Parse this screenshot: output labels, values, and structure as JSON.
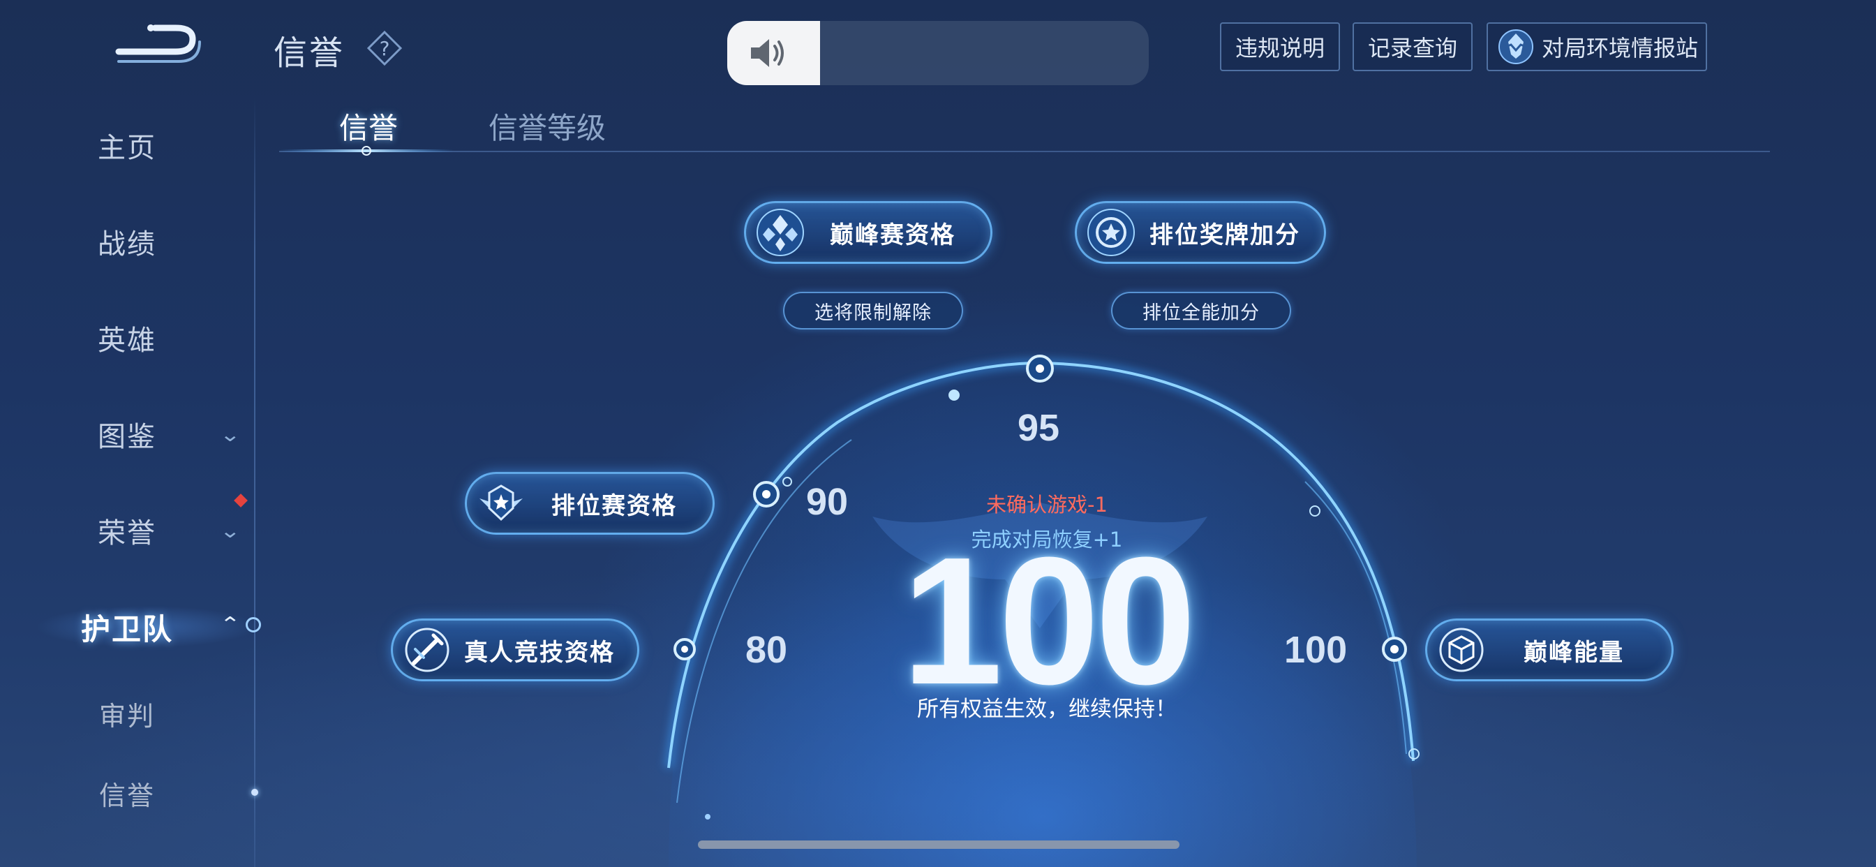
{
  "sidebar": {
    "items": [
      {
        "label": "主页"
      },
      {
        "label": "战绩"
      },
      {
        "label": "英雄"
      },
      {
        "label": "图鉴",
        "expandable": true
      },
      {
        "label": "荣誉",
        "expandable": true,
        "badge": true
      },
      {
        "label": "护卫队",
        "expanded": true,
        "active": true
      },
      {
        "label": "审判"
      },
      {
        "label": "信誉",
        "selected": true
      }
    ]
  },
  "header": {
    "title": "信誉",
    "help_icon": "question-icon",
    "buttons": {
      "violation": "违规说明",
      "records": "记录查询",
      "env_station": "对局环境情报站"
    }
  },
  "volume_hud": {
    "level": 0.22,
    "icon": "speaker-icon"
  },
  "tabs": [
    {
      "label": "信誉",
      "active": true
    },
    {
      "label": "信誉等级",
      "active": false
    }
  ],
  "gauge": {
    "ticks": [
      {
        "value": "80",
        "benefit": "真人竞技资格"
      },
      {
        "value": "90",
        "benefit": "排位赛资格"
      },
      {
        "value": "95",
        "benefit": "巅峰赛资格",
        "sub": "选将限制解除"
      },
      {
        "value": "95",
        "benefit": "排位奖牌加分",
        "sub": "排位全能加分"
      },
      {
        "value": "100",
        "benefit": "巅峰能量"
      }
    ],
    "labels": {
      "t80": "80",
      "t90": "90",
      "t95": "95",
      "t100": "100"
    },
    "score": "100",
    "penalty": "未确认游戏-1",
    "recovery": "完成对局恢复+1",
    "status": "所有权益生效，继续保持！"
  },
  "benefits": {
    "peak_match": "巅峰赛资格",
    "pick_limit": "选将限制解除",
    "ranked_medal": "排位奖牌加分",
    "ranked_allround": "排位全能加分",
    "ranked": "排位赛资格",
    "real_player": "真人竞技资格",
    "peak_energy": "巅峰能量"
  },
  "colors": {
    "accent": "#6ec0ff",
    "penalty": "#ff6b5e",
    "recovery": "#8fd0ff",
    "badge": "#e5433e"
  }
}
